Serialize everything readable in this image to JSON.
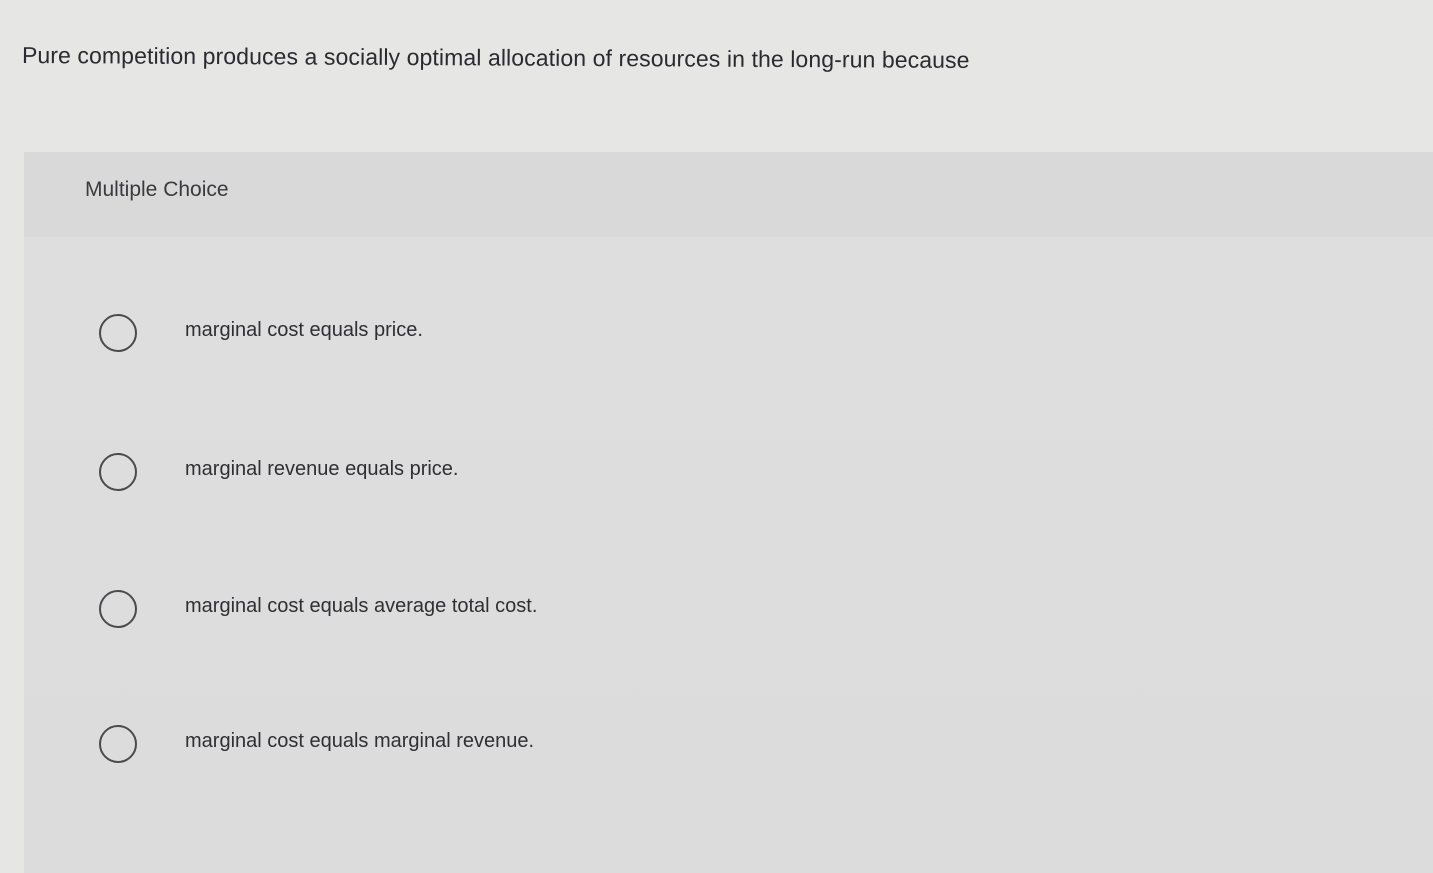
{
  "question": {
    "text": "Pure competition produces a socially optimal allocation of resources in the long-run because"
  },
  "multiple_choice": {
    "title": "Multiple Choice",
    "options": [
      {
        "label": "marginal cost equals price."
      },
      {
        "label": "marginal revenue equals price."
      },
      {
        "label": "marginal cost equals average total cost."
      },
      {
        "label": "marginal cost equals marginal revenue."
      }
    ]
  }
}
